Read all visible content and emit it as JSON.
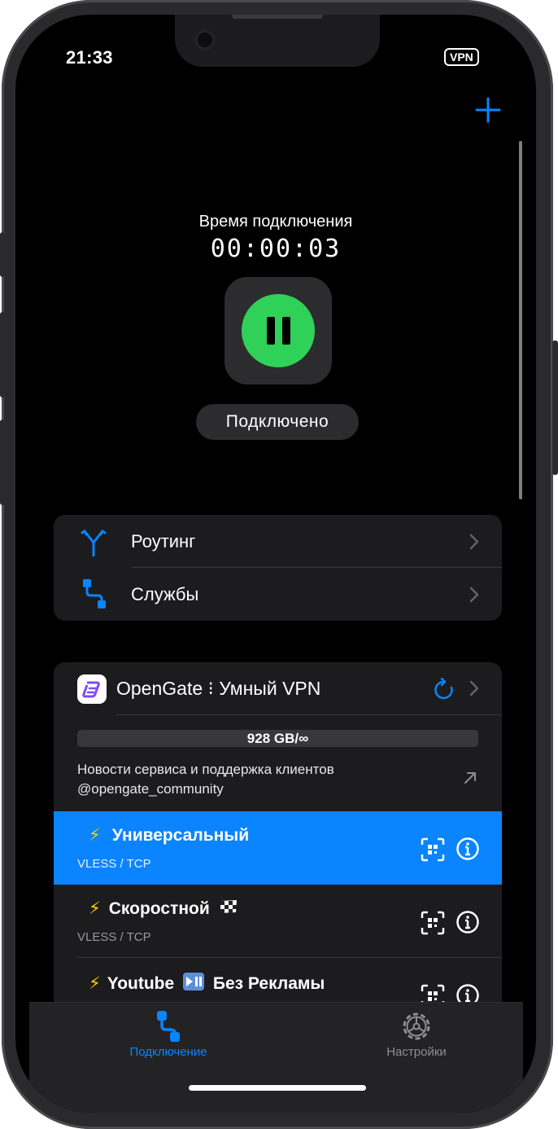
{
  "status_bar": {
    "time": "21:33",
    "vpn_badge": "VPN"
  },
  "toolbar": {
    "add_icon": "plus-icon"
  },
  "connection": {
    "label": "Время подключения",
    "timer": "00:00:03",
    "button_icon": "pause-icon",
    "status": "Подключено",
    "accent_color": "#30d158"
  },
  "menu": {
    "items": [
      {
        "label": "Роутинг",
        "icon": "routing-icon"
      },
      {
        "label": "Службы",
        "icon": "services-icon"
      }
    ]
  },
  "server": {
    "title": "OpenGate ⁝ Умный VPN",
    "traffic": "928 GB/∞",
    "news_line1": "Новости сервиса и поддержка клиентов",
    "news_line2": "@opengate_community",
    "proxies": [
      {
        "name": "Универсальный",
        "suffix": "",
        "protocol": "VLESS / TCP",
        "active": true
      },
      {
        "name": "Скоростной",
        "suffix": "🏁",
        "protocol": "VLESS / TCP",
        "active": false
      },
      {
        "name": "Youtube",
        "suffix": "Без Рекламы",
        "protocol": "",
        "active": false
      }
    ]
  },
  "tabs": [
    {
      "label": "Подключение",
      "icon": "connection-icon",
      "active": true
    },
    {
      "label": "Настройки",
      "icon": "settings-gear-icon",
      "active": false
    }
  ],
  "colors": {
    "accent": "#0a84ff",
    "background": "#000000",
    "card": "#1c1c1e"
  }
}
